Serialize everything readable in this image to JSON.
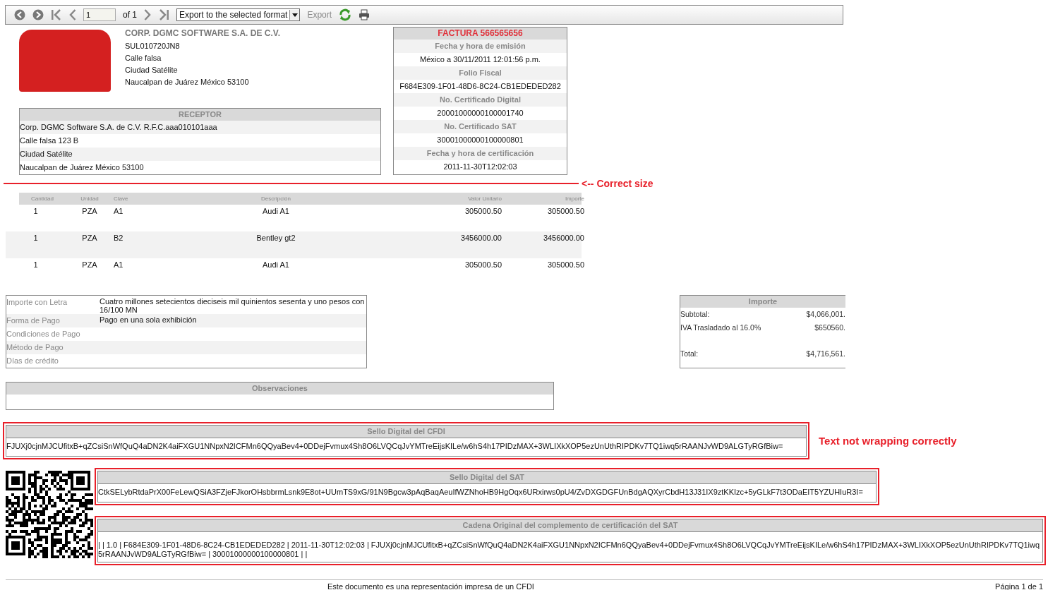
{
  "toolbar": {
    "page": "1",
    "of": "of 1",
    "export_select": "Export to the selected format",
    "export_link": "Export"
  },
  "issuer": {
    "name": "CORP. DGMC SOFTWARE S.A. DE C.V.",
    "lines": [
      "SUL010720JN8",
      "Calle falsa",
      "Ciudad Satélite",
      "Naucalpan de Juárez México 53100"
    ]
  },
  "receptor": {
    "title": "RECEPTOR",
    "lines": [
      "Corp. DGMC Software S.A. de C.V. R.F.C.aaa010101aaa",
      "Calle falsa 123 B",
      "Ciudad Satélite",
      "Naucalpan de Juárez México 53100"
    ]
  },
  "factura": {
    "title": "FACTURA 566565656",
    "rows": [
      {
        "kind": "label",
        "text": "Fecha y hora de emisión"
      },
      {
        "kind": "value",
        "text": "México a 30/11/2011 12:01:56 p.m."
      },
      {
        "kind": "label",
        "text": "Folio Fiscal"
      },
      {
        "kind": "value",
        "text": "F684E309-1F01-48D6-8C24-CB1EDEDED282"
      },
      {
        "kind": "label",
        "text": "No. Certificado Digital"
      },
      {
        "kind": "value",
        "text": "20001000000100001740"
      },
      {
        "kind": "label",
        "text": "No. Certificado SAT"
      },
      {
        "kind": "value",
        "text": "30001000000100000801"
      },
      {
        "kind": "label",
        "text": "Fecha y hora de certificación"
      },
      {
        "kind": "value",
        "text": "2011-11-30T12:02:03"
      }
    ]
  },
  "size_note": {
    "text": "<-- Correct size"
  },
  "table": {
    "columns": [
      "Cantidad",
      "Unidad",
      "Clave",
      "Descripción",
      "Valor Unitario",
      "Importe"
    ],
    "rows": [
      [
        "1",
        "PZA",
        "A1",
        "Audi A1",
        "305000.50",
        "305000.50"
      ],
      [
        "1",
        "PZA",
        "B2",
        "Bentley gt2",
        "3456000.00",
        "3456000.00"
      ],
      [
        "1",
        "PZA",
        "A1",
        "Audi A1",
        "305000.50",
        "305000.50"
      ]
    ]
  },
  "payment": [
    {
      "label": "Importe con Letra",
      "value": "Cuatro millones setecientos dieciseis mil quinientos sesenta y uno pesos con 16/100 MN"
    },
    {
      "label": "Forma de Pago",
      "value": "Pago en una sola exhibición"
    },
    {
      "label": "Condiciones de Pago"
    },
    {
      "label": "Método de Pago"
    },
    {
      "label": "Días de crédito"
    }
  ],
  "totals": {
    "title": "Importe",
    "rows": [
      {
        "kind": "line",
        "label": "Subtotal:",
        "value": "$4,066,001."
      },
      {
        "kind": "line",
        "label": "IVA Trasladado al 16.0%",
        "value": "$650560."
      },
      {
        "kind": "total",
        "label": "Total:",
        "value": "$4,716,561."
      }
    ]
  },
  "observaciones": {
    "title": "Observaciones"
  },
  "sello_cfdi": {
    "title": "Sello Digital del CFDI",
    "text": "FJUXj0cjnMJCUfitxB+qZCsiSnWfQuQ4aDN2K4aiFXGU1NNpxN2ICFMn6QQyaBev4+0DDejFvmux4Sh8O6LVQCqJvYMTreEijsKILe/w6hS4h17PIDzMAX+3WLIXkXOP5ezUnUthRIPDKv7TQ1iwq5rRAANJvWD9ALGTyRGfBiw=",
    "highlighted": true,
    "note": "Text not wrapping correctly"
  },
  "sello_sat": {
    "title": "Sello Digital del SAT",
    "text": "CtkSELybRtdaPrX00FeLewQSiA3FZjeFJkorOHsbbrmLsnk9E8ot+UUmTS9xG/91N9Bgcw3pAqBaqAeuIfWZNhoHB9HgOqx6URxirws0pU4/ZvDXGDGFUnBdgAQXyrCbdH13J31IX9ztKKIzc+5yGLkF7t3ODaEIT5YZUHIuR3I=",
    "highlighted": true
  },
  "cadena": {
    "title": "Cadena Original del complemento de certificación del SAT",
    "text": "| | 1.0 | F684E309-1F01-48D6-8C24-CB1EDEDED282 | 2011-11-30T12:02:03 | FJUXj0cjnMJCUfitxB+qZCsiSnWfQuQ4aDN2K4aiFXGU1NNpxN2ICFMn6QQyaBev4+0DDejFvmux4Sh8O6LVQCqJvYMTreEijsKILe/w6hS4h17PIDzMAX+3WLIXkXOP5ezUnUthRIPDKv7TQ1iwq5rRAANJvWD9ALGTyRGfBiw= | 30001000000100000801 | |",
    "highlighted": true
  },
  "footer": {
    "text": "Este documento es una representación impresa de un CFDI",
    "page": "Página 1 de 1"
  }
}
